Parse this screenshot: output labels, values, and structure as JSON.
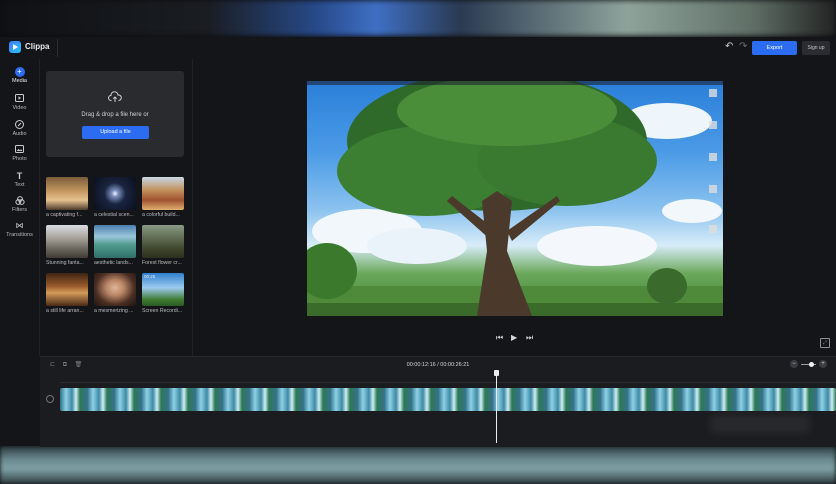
{
  "app": {
    "name": "Clippa"
  },
  "header": {
    "export_label": "Export",
    "signup_label": "Sign up"
  },
  "rail": [
    {
      "label": "Media",
      "icon": "plus-icon"
    },
    {
      "label": "Video",
      "icon": "video-icon"
    },
    {
      "label": "Audio",
      "icon": "audio-icon"
    },
    {
      "label": "Photo",
      "icon": "photo-icon"
    },
    {
      "label": "Text",
      "icon": "text-icon"
    },
    {
      "label": "Filters",
      "icon": "filters-icon"
    },
    {
      "label": "Transitions",
      "icon": "transitions-icon"
    }
  ],
  "media": {
    "drop_text": "Drag & drop a file here or",
    "upload_label": "Upload a file",
    "items": [
      {
        "caption": "a captivating f..."
      },
      {
        "caption": "a celestial scen..."
      },
      {
        "caption": "a colorful build..."
      },
      {
        "caption": "Stunning fanta..."
      },
      {
        "caption": "aesthetic lands..."
      },
      {
        "caption": "Forest flower cr..."
      },
      {
        "caption": "a still life arran..."
      },
      {
        "caption": "a mesmerizing ..."
      },
      {
        "caption": "Screen Recordi...",
        "duration": "00:26"
      }
    ]
  },
  "timeline": {
    "timecode": "00:00:12:16 / 00:00:26:21"
  },
  "colors": {
    "accent": "#2b6cf3",
    "background": "#141518"
  }
}
